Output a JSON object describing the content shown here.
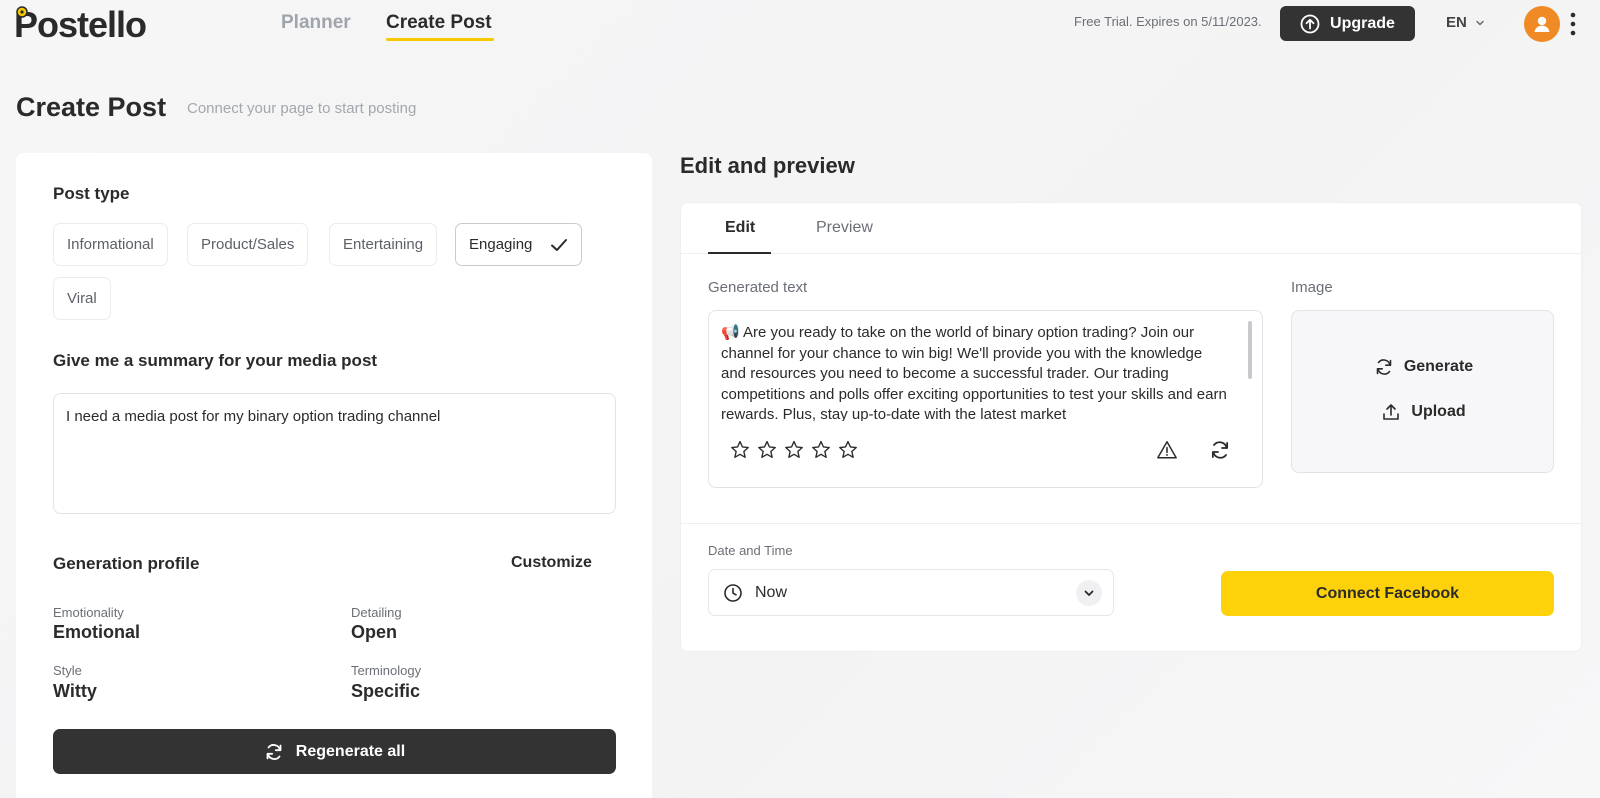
{
  "header": {
    "logo_text": "Postello",
    "nav": [
      {
        "label": "Planner"
      },
      {
        "label": "Create Post"
      }
    ],
    "trial_text": "Free Trial. Expires on 5/11/2023.",
    "upgrade_label": "Upgrade",
    "language": "EN"
  },
  "page": {
    "title": "Create Post",
    "subtitle": "Connect your page to start posting"
  },
  "post_type": {
    "title": "Post type",
    "options": [
      {
        "label": "Informational",
        "selected": false
      },
      {
        "label": "Product/Sales",
        "selected": false
      },
      {
        "label": "Entertaining",
        "selected": false
      },
      {
        "label": "Engaging",
        "selected": true
      },
      {
        "label": "Viral",
        "selected": false
      }
    ]
  },
  "summary": {
    "title": "Give me a summary for your media post",
    "value": "I need a media post for my binary option trading channel"
  },
  "profile": {
    "title": "Generation profile",
    "customize_label": "Customize",
    "fields": [
      {
        "label": "Emotionality",
        "value": "Emotional"
      },
      {
        "label": "Detailing",
        "value": "Open"
      },
      {
        "label": "Style",
        "value": "Witty"
      },
      {
        "label": "Terminology",
        "value": "Specific"
      }
    ],
    "regenerate_label": "Regenerate all"
  },
  "preview": {
    "title": "Edit and preview",
    "tabs": [
      {
        "label": "Edit",
        "active": true
      },
      {
        "label": "Preview",
        "active": false
      }
    ],
    "generated_text_label": "Generated text",
    "generated_text": "📢 Are you ready to take on the world of binary option trading? Join our channel for your chance to win big! We'll provide you with the knowledge and resources you need to become a successful trader. Our trading competitions and polls offer exciting opportunities to test your skills and earn rewards. Plus, stay up-to-date with the latest market",
    "rating": 0,
    "rating_max": 5,
    "image_label": "Image",
    "generate_label": "Generate",
    "upload_label": "Upload",
    "datetime_label": "Date and Time",
    "datetime_value": "Now",
    "connect_label": "Connect Facebook"
  },
  "colors": {
    "accent_yellow": "#fdd20a",
    "dark_button": "#333333",
    "avatar_orange": "#f08a24"
  }
}
